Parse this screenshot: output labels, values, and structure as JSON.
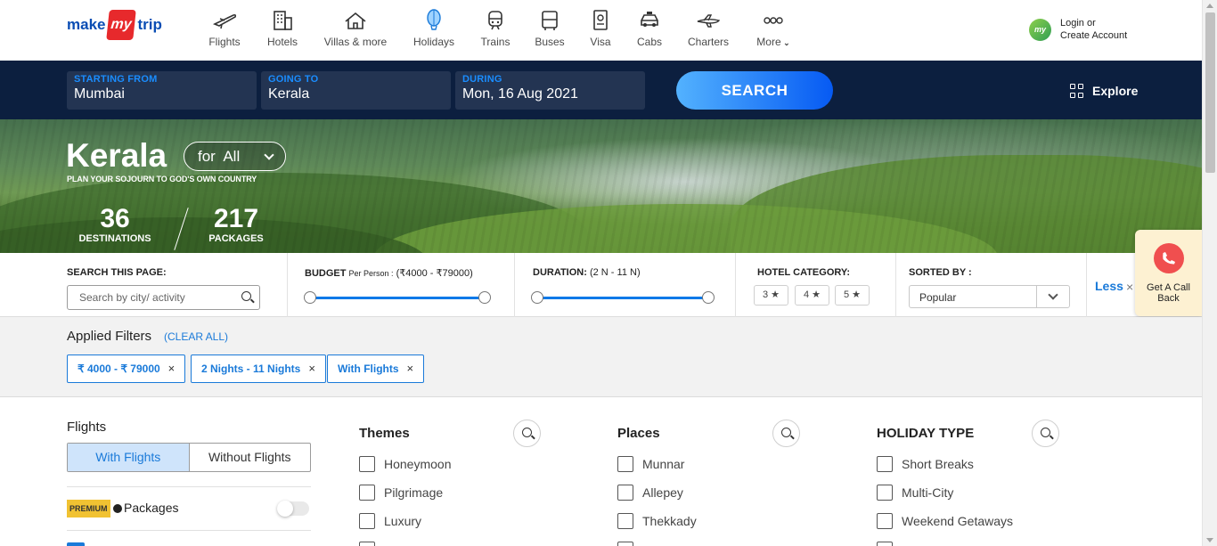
{
  "brand": {
    "make": "make",
    "my": "my",
    "trip": "trip"
  },
  "nav": [
    {
      "label": "Flights",
      "icon": "flight-icon"
    },
    {
      "label": "Hotels",
      "icon": "hotel-icon"
    },
    {
      "label": "Villas & more",
      "icon": "villa-icon"
    },
    {
      "label": "Holidays",
      "icon": "holiday-balloon-icon"
    },
    {
      "label": "Trains",
      "icon": "train-icon"
    },
    {
      "label": "Buses",
      "icon": "bus-icon"
    },
    {
      "label": "Visa",
      "icon": "visa-icon"
    },
    {
      "label": "Cabs",
      "icon": "cab-icon"
    },
    {
      "label": "Charters",
      "icon": "charter-icon"
    },
    {
      "label": "More",
      "icon": "more-icon"
    }
  ],
  "account": {
    "avatar_text": "my",
    "line1": "Login or",
    "line2": "Create Account"
  },
  "search": {
    "from_label": "STARTING FROM",
    "from_value": "Mumbai",
    "to_label": "GOING TO",
    "to_value": "Kerala",
    "during_label": "DURING",
    "during_value": "Mon, 16 Aug 2021",
    "button": "SEARCH",
    "explore": "Explore"
  },
  "hero": {
    "title": "Kerala",
    "for_pill": "for  All",
    "tagline": "PLAN YOUR SOJOURN TO GOD'S OWN COUNTRY",
    "destinations_count": "36",
    "destinations_label": "DESTINATIONS",
    "packages_count": "217",
    "packages_label": "PACKAGES"
  },
  "filters": {
    "search_label": "SEARCH THIS PAGE:",
    "search_placeholder": "Search by city/ activity",
    "budget_label": "BUDGET",
    "budget_sub": "Per Person :",
    "budget_range": "(₹4000 - ₹79000)",
    "budget_min_fraction": 0,
    "budget_max_fraction": 1,
    "duration_label": "DURATION:",
    "duration_range": "(2 N - 11 N)",
    "duration_min_fraction": 0,
    "duration_max_fraction": 1,
    "hotel_label": "HOTEL CATEGORY:",
    "hotel_options": [
      "3 ★",
      "4 ★",
      "5 ★"
    ],
    "sort_label": "SORTED BY :",
    "sort_value": "Popular",
    "less": "Less",
    "less_close": "×"
  },
  "callback": {
    "label": "Get A Call Back"
  },
  "applied": {
    "title": "Applied Filters",
    "clear_all": "(CLEAR ALL)",
    "chips": [
      "₹ 4000 - ₹ 79000",
      "2 Nights - 11 Nights",
      "With Flights"
    ],
    "chip_close": "×"
  },
  "flights_filter": {
    "title": "Flights",
    "options": [
      "With Flights",
      "Without Flights"
    ],
    "selected": "With Flights",
    "premium_badge": "PREMIUM",
    "packages_label": "Packages",
    "premium_toggle_on": false
  },
  "themes": {
    "title": "Themes",
    "items": [
      "Honeymoon",
      "Pilgrimage",
      "Luxury"
    ]
  },
  "places": {
    "title": "Places",
    "items": [
      "Munnar",
      "Allepey",
      "Thekkady"
    ]
  },
  "holiday_type": {
    "title": "HOLIDAY TYPE",
    "items": [
      "Short Breaks",
      "Multi-City",
      "Weekend Getaways"
    ]
  },
  "colors": {
    "header_dark": "#0c1f3f",
    "accent_blue": "#1a7ad9",
    "brand_red": "#e7292c",
    "callback_bg": "#fdf1d2"
  }
}
